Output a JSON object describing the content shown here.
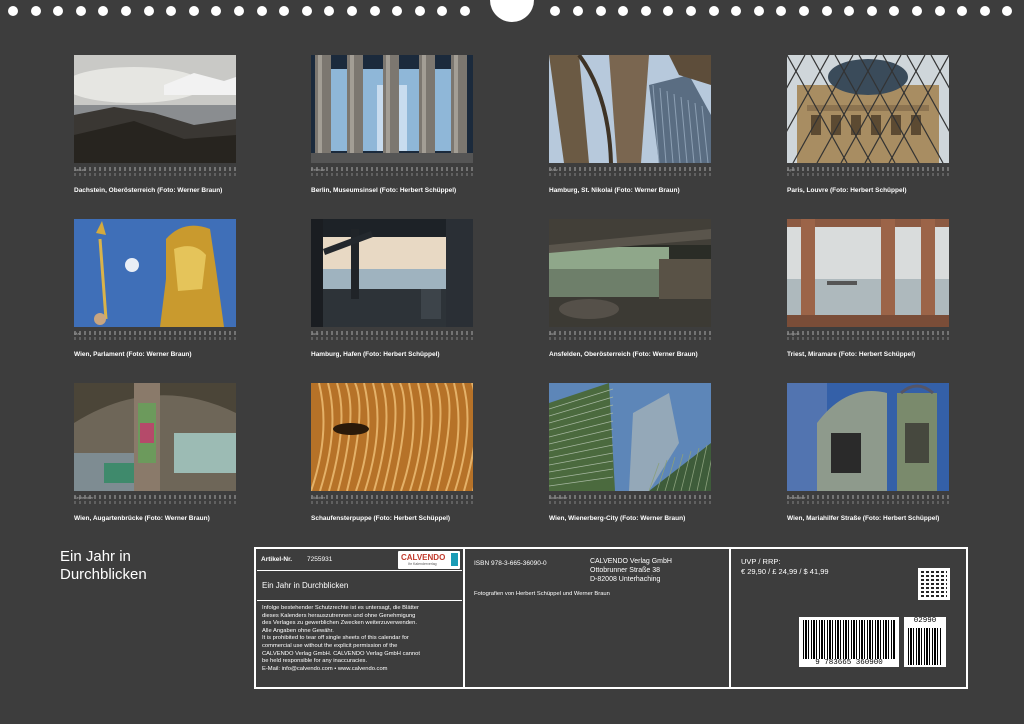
{
  "calendar_title": [
    "Ein Jahr in",
    "Durchblicken"
  ],
  "months": [
    {
      "name": "Januar",
      "caption": "Dachstein, Oberösterreich (Foto: Werner Braun)",
      "scene": "mountain"
    },
    {
      "name": "Februar",
      "caption": "Berlin, Museumsinsel (Foto: Herbert Schüppel)",
      "scene": "columns"
    },
    {
      "name": "März",
      "caption": "Hamburg, St. Nikolai (Foto: Werner Braun)",
      "scene": "gothic"
    },
    {
      "name": "April",
      "caption": "Paris, Louvre (Foto: Herbert Schüppel)",
      "scene": "louvre"
    },
    {
      "name": "Mai",
      "caption": "Wien, Parlament (Foto: Werner Braun)",
      "scene": "athena"
    },
    {
      "name": "Juni",
      "caption": "Hamburg, Hafen (Foto: Herbert Schüppel)",
      "scene": "harbor"
    },
    {
      "name": "Juli",
      "caption": "Ansfelden, Oberösterreich (Foto: Werner Braun)",
      "scene": "river"
    },
    {
      "name": "August",
      "caption": "Triest, Miramare (Foto: Herbert Schüppel)",
      "scene": "sea"
    },
    {
      "name": "September",
      "caption": "Wien, Augartenbrücke (Foto: Werner Braun)",
      "scene": "bridge"
    },
    {
      "name": "Oktober",
      "caption": "Schaufensterpuppe (Foto: Herbert Schüppel)",
      "scene": "mannequin"
    },
    {
      "name": "November",
      "caption": "Wien, Wienerberg-City (Foto: Werner Braun)",
      "scene": "towers"
    },
    {
      "name": "Dezember",
      "caption": "Wien, Mariahilfer Straße (Foto: Herbert Schüppel)",
      "scene": "mirror"
    }
  ],
  "info": {
    "artikel_label": "Artikel-Nr.",
    "artikel_no": "7255931",
    "calvendo_logo": "CALVENDO",
    "calvendo_sub": "Ihr Kalenderverlag",
    "subtitle": "Ein Jahr in Durchblicken",
    "legal": [
      "Infolge bestehender Schutzrechte ist es untersagt, die Blätter",
      "dieses Kalenders herauszutrennen und ohne Genehmigung",
      "des Verlages zu gewerblichen Zwecken weiterzuverwenden.",
      "Alle Angaben ohne Gewähr.",
      "It is prohibited to tear off single sheets of this calendar for",
      "commercial use without the explicit permission of the",
      "CALVENDO Verlag GmbH. CALVENDO Verlag GmbH cannot",
      "be held responsible for any inaccuracies.",
      "E-Mail: info@calvendo.com • www.calvendo.com"
    ],
    "isbn": "ISBN 978-3-665-36090-0",
    "publisher": [
      "CALVENDO Verlag GmbH",
      "Ottobrunner Straße 38",
      "D-82008 Unterhaching"
    ],
    "photographers": "Fotografien von Herbert Schüppel und Werner Braun",
    "price_label": "UVP / RRP:",
    "price": "€ 29,90 / £ 24,99 / $ 41,99",
    "barcode_number": "9 783665 360900",
    "barcode_addon": "02990"
  }
}
